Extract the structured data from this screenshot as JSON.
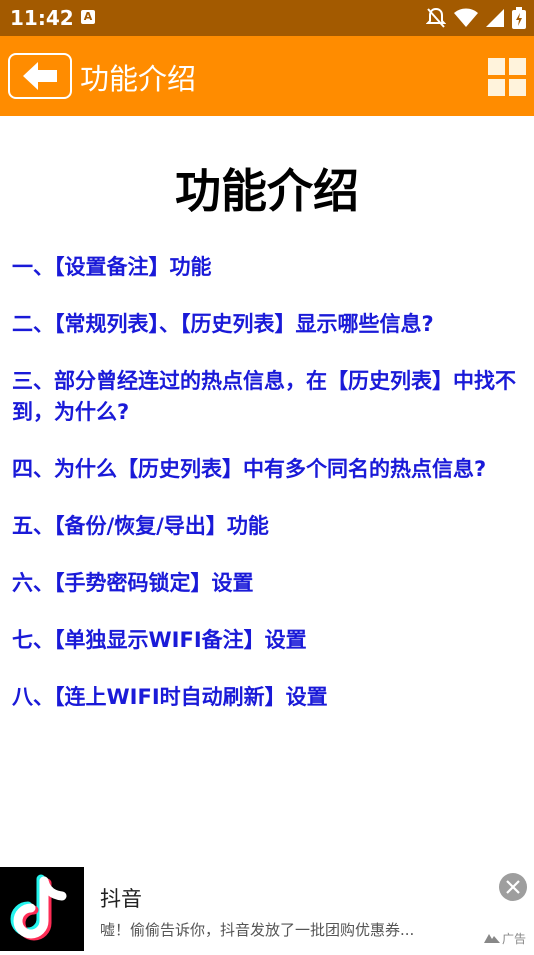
{
  "status_bar": {
    "time": "11:42",
    "notification_badge": "A",
    "icons": [
      "mute-icon",
      "wifi-icon",
      "signal-icon",
      "battery-icon"
    ]
  },
  "app_bar": {
    "title": "功能介绍",
    "back_icon": "arrow-left-icon",
    "menu_icon": "grid-icon",
    "background": "#ff8c00"
  },
  "main": {
    "title": "功能介绍",
    "link_color": "#1a1ad8",
    "items": [
      {
        "label": "一、【设置备注】功能"
      },
      {
        "label": "二、【常规列表】、【历史列表】显示哪些信息?"
      },
      {
        "label": "三、部分曾经连过的热点信息，在【历史列表】中找不到，为什么?"
      },
      {
        "label": "四、为什么【历史列表】中有多个同名的热点信息?"
      },
      {
        "label": "五、【备份/恢复/导出】功能"
      },
      {
        "label": "六、【手势密码锁定】设置"
      },
      {
        "label": "七、【单独显示WIFI备注】设置"
      },
      {
        "label": "八、【连上WIFI时自动刷新】设置"
      }
    ]
  },
  "ad": {
    "app_name": "抖音",
    "description": "嘘！偷偷告诉你，抖音发放了一批团购优惠券...",
    "tag": "广告"
  }
}
